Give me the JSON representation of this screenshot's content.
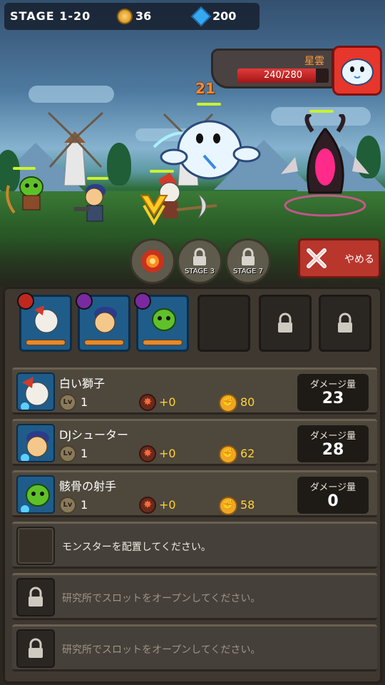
{
  "topbar": {
    "stage": "STAGE  1-20",
    "coins": "36",
    "gems": "200"
  },
  "boss": {
    "name": "星雲",
    "hp": "240/280",
    "hp_fraction": 0.857
  },
  "battle": {
    "damage_popup": "21"
  },
  "skills": [
    {
      "label": ""
    },
    {
      "label": "STAGE 3"
    },
    {
      "label": "STAGE 7"
    }
  ],
  "cancel_label": "やめる",
  "monsters": [
    {
      "name": "白い獅子",
      "level": "1",
      "bonus": "+0",
      "attack": "80",
      "damage_title": "ダメージ量",
      "damage": "23"
    },
    {
      "name": "DJシューター",
      "level": "1",
      "bonus": "+0",
      "attack": "62",
      "damage_title": "ダメージ量",
      "damage": "28"
    },
    {
      "name": "骸骨の射手",
      "level": "1",
      "bonus": "+0",
      "attack": "58",
      "damage_title": "ダメージ量",
      "damage": "0"
    }
  ],
  "lv_badge": "Lv",
  "slots": {
    "empty_msg": "モンスターを配置してください。",
    "locked_msg": "研究所でスロットをオープンしてください。"
  }
}
